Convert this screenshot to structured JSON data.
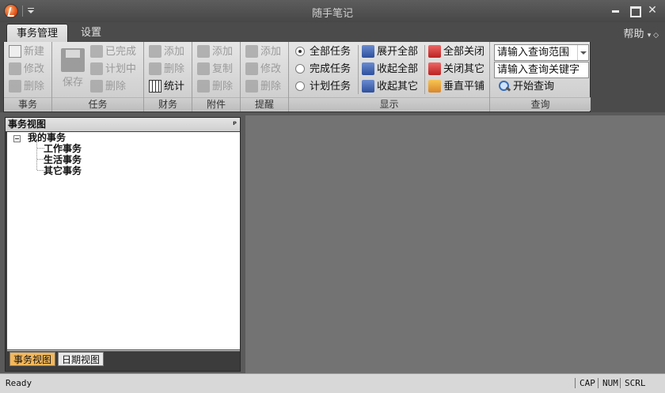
{
  "window": {
    "title": "随手笔记"
  },
  "tabs": [
    {
      "label": "事务管理",
      "active": true
    },
    {
      "label": "设置",
      "active": false
    }
  ],
  "help": {
    "label": "帮助",
    "suffix": "▾ ◇"
  },
  "ribbon": {
    "groups": [
      {
        "label": "事务",
        "items": [
          "新建",
          "修改",
          "删除"
        ]
      },
      {
        "label": "任务",
        "save": "保存",
        "items": [
          "已完成",
          "计划中",
          "删除"
        ]
      },
      {
        "label": "财务",
        "items": [
          "添加",
          "删除",
          "统计"
        ]
      },
      {
        "label": "附件",
        "items": [
          "添加",
          "复制",
          "删除"
        ]
      },
      {
        "label": "提醒",
        "items": [
          "添加",
          "修改",
          "删除"
        ]
      },
      {
        "label": "显示",
        "radios": [
          "全部任务",
          "完成任务",
          "计划任务"
        ],
        "selected": "全部任务",
        "items": [
          "展开全部",
          "收起全部",
          "收起其它",
          "全部关闭",
          "关闭其它",
          "垂直平铺"
        ]
      },
      {
        "label": "查询",
        "range_combo": "请输入查询范围",
        "keyword_field": "请输入查询关键字",
        "search_button": "开始查询"
      }
    ]
  },
  "panel": {
    "title": "事务视图",
    "pin": "ᵖ",
    "tree": {
      "root": "我的事务",
      "children": [
        "工作事务",
        "生活事务",
        "其它事务"
      ]
    },
    "tabs": [
      {
        "label": "事务视图",
        "active": true
      },
      {
        "label": "日期视图",
        "active": false
      }
    ]
  },
  "statusbar": {
    "text": "Ready",
    "indicators": [
      "CAP",
      "NUM",
      "SCRL"
    ]
  }
}
